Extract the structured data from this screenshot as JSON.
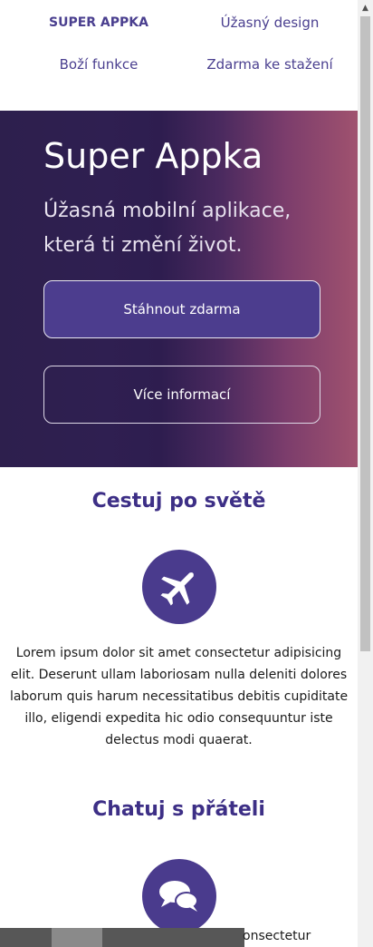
{
  "nav": {
    "brand": "SUPER APPKA",
    "items": [
      "Úžasný design",
      "Boží funkce",
      "Zdarma ke stažení"
    ]
  },
  "hero": {
    "title": "Super Appka",
    "subtitle": "Úžasná mobilní aplikace, která ti změní život.",
    "primary_button": "Stáhnout zdarma",
    "secondary_button": "Více informací"
  },
  "features": [
    {
      "title": "Cestuj po světě",
      "icon": "airplane-icon",
      "text": "Lorem ipsum dolor sit amet consectetur adipisicing elit. Deserunt ullam laboriosam nulla deleniti dolores laborum quis harum necessitatibus debitis cupiditate illo, eligendi expedita hic odio consequuntur iste delectus modi quaerat."
    },
    {
      "title": "Chatuj s přáteli",
      "icon": "chat-bubbles-icon"
    }
  ],
  "partial_text": "onsectetur",
  "colors": {
    "accent": "#4a3b8d",
    "heading": "#3d2f86",
    "hero_left": "#2d1f4d",
    "hero_right": "#a0526f"
  }
}
